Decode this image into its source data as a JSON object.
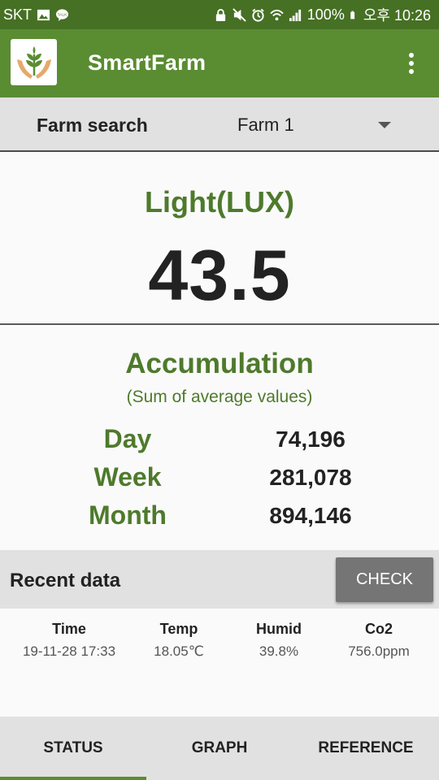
{
  "status_bar": {
    "carrier": "SKT",
    "battery": "100%",
    "time": "오후 10:26"
  },
  "app": {
    "title": "SmartFarm",
    "colors": {
      "status_bar": "#467024",
      "app_bar": "#5a8c32",
      "accent_text": "#4e7a2c"
    }
  },
  "farm_search": {
    "label": "Farm search",
    "selected": "Farm 1"
  },
  "light": {
    "title": "Light(LUX)",
    "value": "43.5"
  },
  "accumulation": {
    "title": "Accumulation",
    "subtitle": "(Sum of average values)",
    "rows": [
      {
        "label": "Day",
        "value": "74,196"
      },
      {
        "label": "Week",
        "value": "281,078"
      },
      {
        "label": "Month",
        "value": "894,146"
      }
    ]
  },
  "recent": {
    "title": "Recent data",
    "check_label": "CHECK",
    "columns": [
      {
        "header": "Time",
        "value": "19-11-28 17:33"
      },
      {
        "header": "Temp",
        "value": "18.05℃"
      },
      {
        "header": "Humid",
        "value": "39.8%"
      },
      {
        "header": "Co2",
        "value": "756.0ppm"
      }
    ]
  },
  "tabs": [
    {
      "label": "STATUS",
      "active": true
    },
    {
      "label": "GRAPH",
      "active": false
    },
    {
      "label": "REFERENCE",
      "active": false
    }
  ]
}
